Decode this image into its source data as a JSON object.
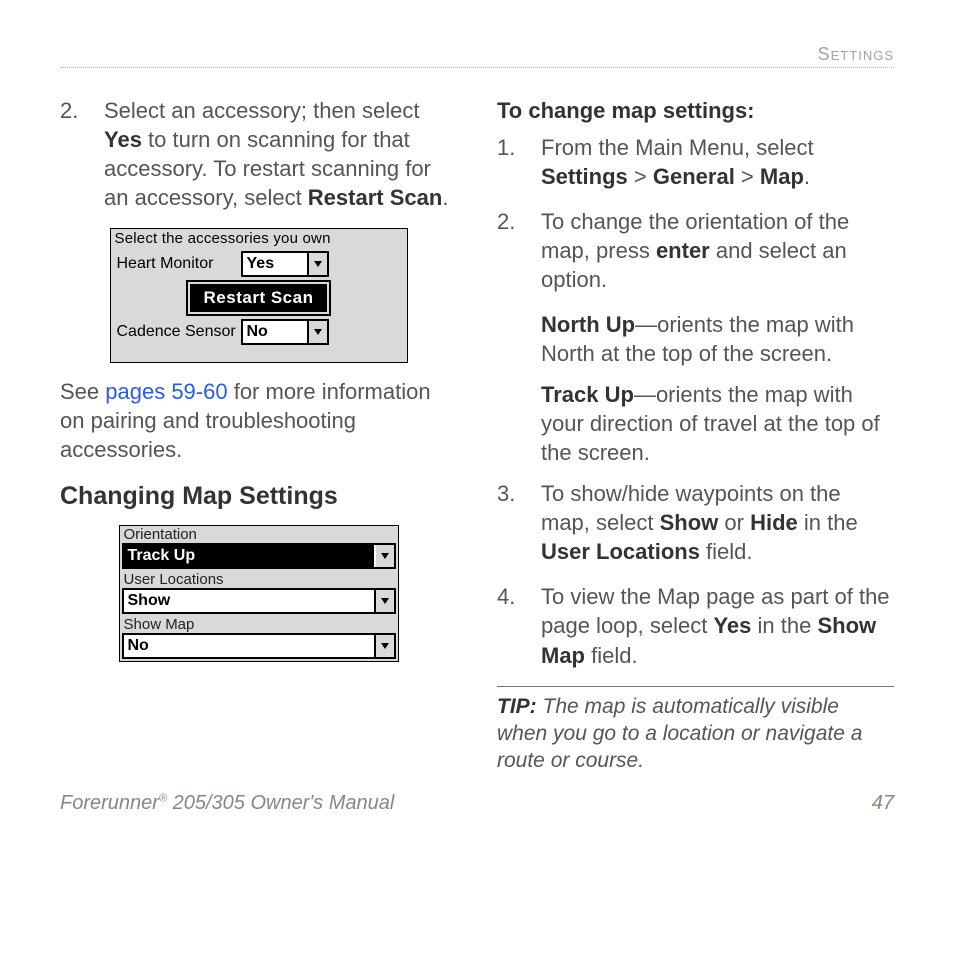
{
  "running_head": "Settings",
  "left": {
    "step2_num": "2.",
    "step2_p1a": "Select an accessory; then select ",
    "step2_p1b": "Yes",
    "step2_p1c": " to turn on scanning for that accessory. To restart scanning for an accessory, select ",
    "step2_p1d": "Restart Scan",
    "step2_p1e": ".",
    "device_acc": {
      "title": "Select the accessories you own",
      "row1_label": "Heart Monitor",
      "row1_value": "Yes",
      "button": "Restart Scan",
      "row2_label": "Cadence Sensor",
      "row2_value": "No"
    },
    "para_see_a": "See ",
    "para_see_link": "pages 59-60",
    "para_see_b": " for more information on pairing and troubleshooting accessories.",
    "heading": "Changing Map Settings",
    "device_map": {
      "label1": "Orientation",
      "value1": "Track Up",
      "label2": "User Locations",
      "value2": "Show",
      "label3": "Show Map",
      "value3": "No"
    }
  },
  "right": {
    "heading": "To change map settings:",
    "s1_num": "1.",
    "s1_a": "From the Main Menu, select ",
    "s1_b": "Settings",
    "s1_c": " > ",
    "s1_d": "General",
    "s1_e": " > ",
    "s1_f": "Map",
    "s1_g": ".",
    "s2_num": "2.",
    "s2_a": "To change the orientation of the map, press ",
    "s2_b": "enter",
    "s2_c": " and select an option.",
    "northup_a": "North Up",
    "northup_b": "—orients the map with North at the top of the screen.",
    "trackup_a": "Track Up",
    "trackup_b": "—orients the map with your direction of travel at the top of the screen.",
    "s3_num": "3.",
    "s3_a": "To show/hide waypoints on the map, select ",
    "s3_b": "Show",
    "s3_c": " or ",
    "s3_d": "Hide",
    "s3_e": " in the ",
    "s3_f": "User Locations",
    "s3_g": " field.",
    "s4_num": "4.",
    "s4_a": "To view the Map page as part of the page loop, select ",
    "s4_b": "Yes",
    "s4_c": " in the ",
    "s4_d": "Show Map",
    "s4_e": " field.",
    "tip_label": "TIP:",
    "tip_text": " The map is automatically visible when you go to a location or navigate a route or course."
  },
  "footer": {
    "left_a": "Forerunner",
    "left_sup": "®",
    "left_b": " 205/305 Owner's Manual",
    "pagenum": "47"
  }
}
